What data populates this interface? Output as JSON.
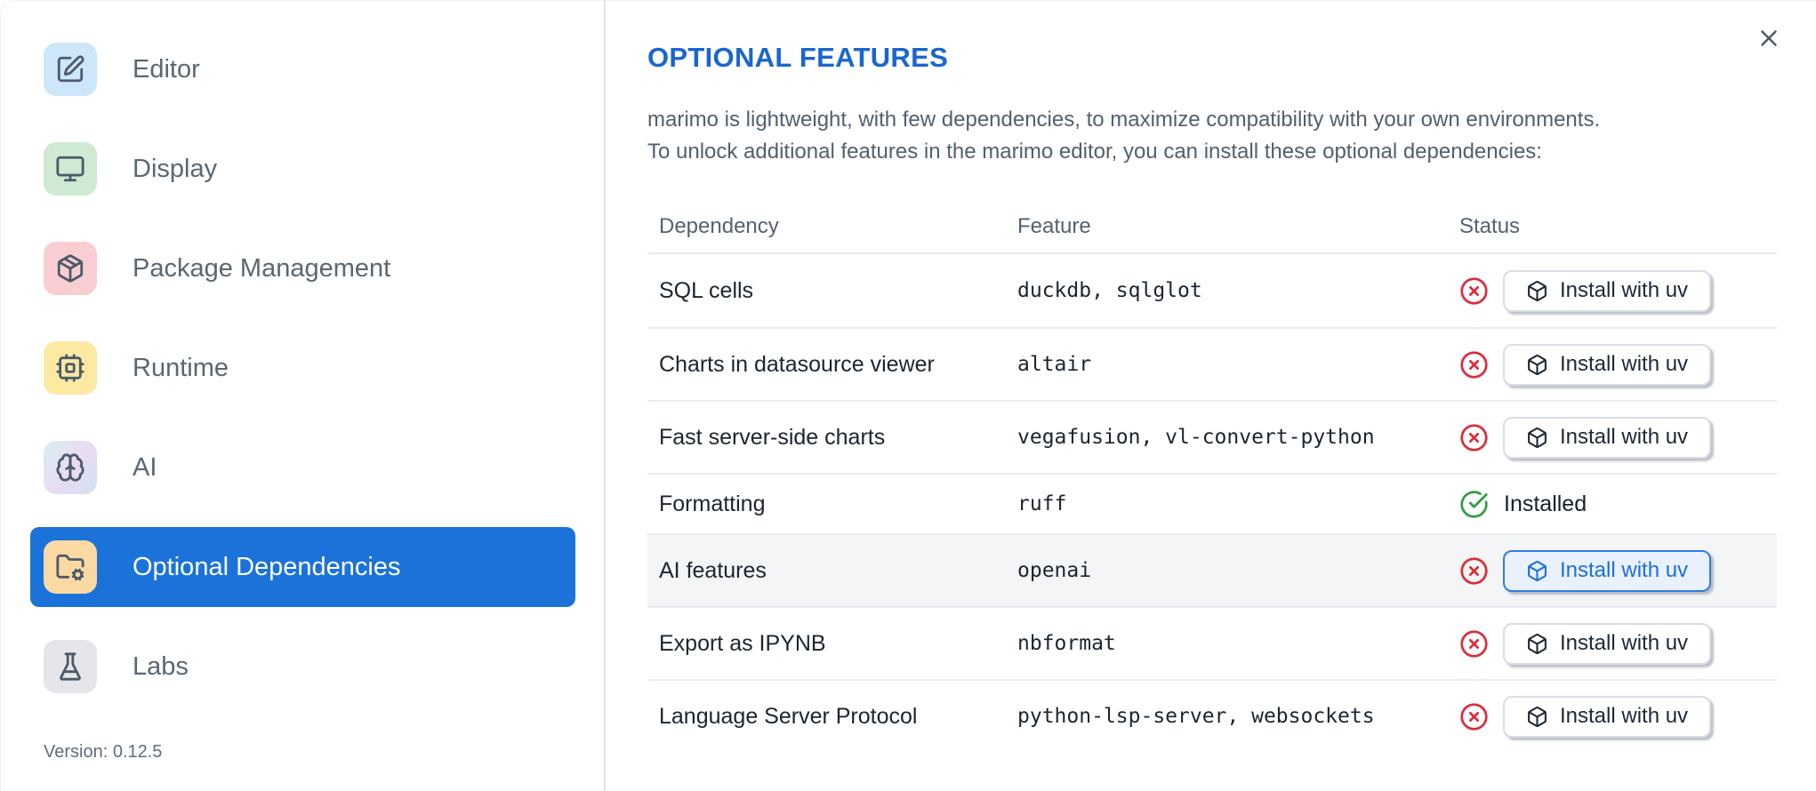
{
  "sidebar": {
    "items": [
      {
        "label": "Editor",
        "icon": "square-pen-icon",
        "icon_bg": "#cde6f9",
        "selected": false
      },
      {
        "label": "Display",
        "icon": "monitor-icon",
        "icon_bg": "#cfe9d3",
        "selected": false
      },
      {
        "label": "Package Management",
        "icon": "package-icon",
        "icon_bg": "#f9ced2",
        "selected": false
      },
      {
        "label": "Runtime",
        "icon": "cpu-icon",
        "icon_bg": "#fce9a2",
        "selected": false
      },
      {
        "label": "AI",
        "icon": "brain-icon",
        "icon_bg": "gradient",
        "selected": false
      },
      {
        "label": "Optional Dependencies",
        "icon": "folder-cog-icon",
        "icon_bg": "#fbd9a3",
        "selected": true
      },
      {
        "label": "Labs",
        "icon": "flask-icon",
        "icon_bg": "#e5e6e9",
        "selected": false
      }
    ],
    "version": "Version: 0.12.5"
  },
  "main": {
    "title": "OPTIONAL FEATURES",
    "description_lines": [
      "marimo is lightweight, with few dependencies, to maximize compatibility with your own environments.",
      "To unlock additional features in the marimo editor, you can install these optional dependencies:"
    ],
    "table": {
      "headers": [
        "Dependency",
        "Feature",
        "Status"
      ],
      "rows": [
        {
          "dependency": "SQL cells",
          "feature": "duckdb, sqlglot",
          "installed": false,
          "button_label": "Install with uv",
          "highlighted": false
        },
        {
          "dependency": "Charts in datasource viewer",
          "feature": "altair",
          "installed": false,
          "button_label": "Install with uv",
          "highlighted": false
        },
        {
          "dependency": "Fast server-side charts",
          "feature": "vegafusion, vl-convert-python",
          "installed": false,
          "button_label": "Install with uv",
          "highlighted": false
        },
        {
          "dependency": "Formatting",
          "feature": "ruff",
          "installed": true,
          "status_label": "Installed",
          "highlighted": false
        },
        {
          "dependency": "AI features",
          "feature": "openai",
          "installed": false,
          "button_label": "Install with uv",
          "highlighted": true
        },
        {
          "dependency": "Export as IPYNB",
          "feature": "nbformat",
          "installed": false,
          "button_label": "Install with uv",
          "highlighted": false
        },
        {
          "dependency": "Language Server Protocol",
          "feature": "python-lsp-server, websockets",
          "installed": false,
          "button_label": "Install with uv",
          "highlighted": false
        }
      ]
    }
  },
  "colors": {
    "accent_blue": "#1b73d9",
    "title_blue": "#1a66cf",
    "status_missing_red": "#d92f3c",
    "status_installed_green": "#2f9e44",
    "highlight_button_border": "#2f7ce0",
    "highlight_button_bg": "#e9f1fc",
    "row_highlight_bg": "#f4f5f7",
    "table_border": "#e8ecf3",
    "sidebar_border": "#dde3ee"
  }
}
